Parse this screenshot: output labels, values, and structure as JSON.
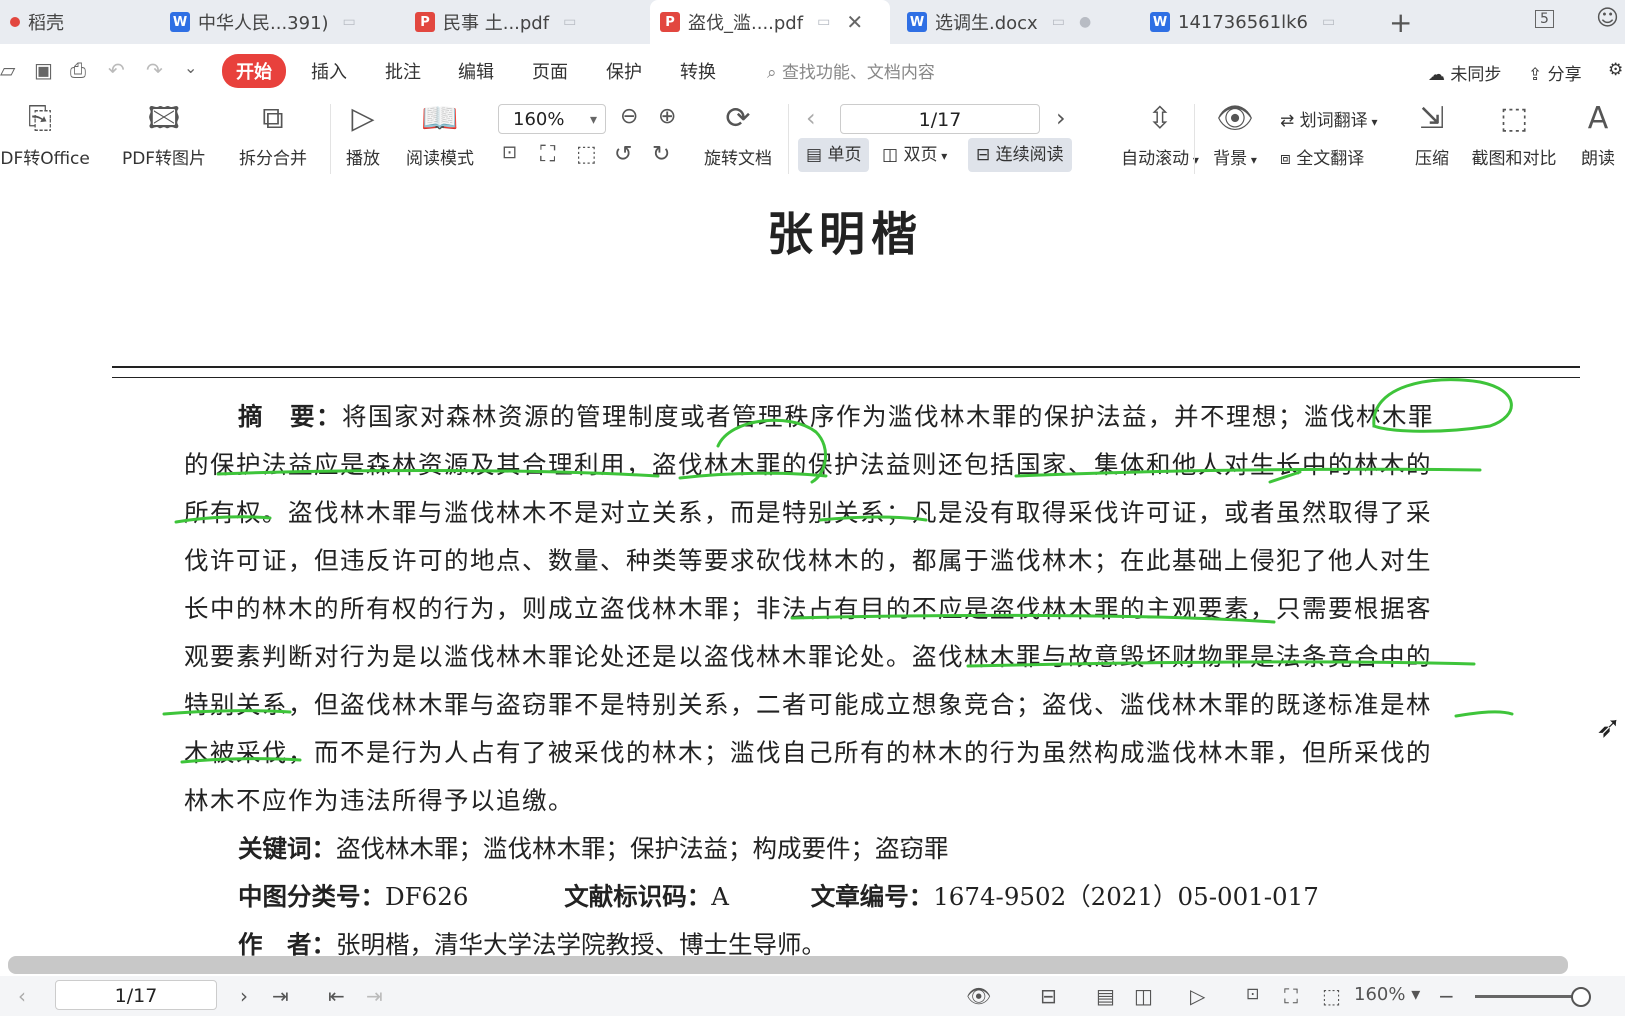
{
  "tabs": [
    {
      "label": "稻壳",
      "icon": "docer-icon"
    },
    {
      "label": "中华人民...391)",
      "icon": "word-icon"
    },
    {
      "label": "民事 土...pdf",
      "icon": "pdf-icon"
    },
    {
      "label": "盗伐_滥....pdf",
      "icon": "pdf-icon",
      "active": true
    },
    {
      "label": "选调生.docx",
      "icon": "word-icon"
    },
    {
      "label": "141736561lk6",
      "icon": "word-icon"
    }
  ],
  "tab_count_badge": "5",
  "menu": {
    "items": [
      "开始",
      "插入",
      "批注",
      "编辑",
      "页面",
      "保护",
      "转换"
    ],
    "search_placeholder": "查找功能、文档内容",
    "sync_label": "未同步",
    "share_label": "分享"
  },
  "toolbar": {
    "pdf_to_office": "PDF转Office",
    "pdf_to_image": "PDF转图片",
    "split_merge": "拆分合并",
    "play": "播放",
    "read_mode": "阅读模式",
    "zoom": "160%",
    "rotate_doc": "旋转文档",
    "page_indicator": "1/17",
    "single_page": "单页",
    "double_page": "双页",
    "continuous": "连续阅读",
    "auto_scroll": "自动滚动",
    "background": "背景",
    "word_translate": "划词翻译",
    "full_translate": "全文翻译",
    "compress": "压缩",
    "screenshot_compare": "截图和对比",
    "read_aloud": "朗读"
  },
  "document": {
    "title": "张明楷",
    "abstract_label": "摘　要：",
    "lines": [
      "将国家对森林资源的管理制度或者管理秩序作为滥伐林木罪的保护法益，并不理想；滥伐林木罪",
      "的保护法益应是森林资源及其合理利用，盗伐林木罪的保护法益则还包括国家、集体和他人对生长中的林木的",
      "所有权。盗伐林木罪与滥伐林木不是对立关系，而是特别关系；凡是没有取得采伐许可证，或者虽然取得了采",
      "伐许可证，但违反许可的地点、数量、种类等要求砍伐林木的，都属于滥伐林木；在此基础上侵犯了他人对生",
      "长中的林木的所有权的行为，则成立盗伐林木罪；非法占有目的不应是盗伐林木罪的主观要素，只需要根据客",
      "观要素判断对行为是以滥伐林木罪论处还是以盗伐林木罪论处。盗伐林木罪与故意毁坏财物罪是法条竞合中的",
      "特别关系，但盗伐林木罪与盗窃罪不是特别关系，二者可能成立想象竞合；盗伐、滥伐林木罪的既遂标准是林",
      "木被采伐，而不是行为人占有了被采伐的林木；滥伐自己所有的林木的行为虽然构成滥伐林木罪，但所采伐的",
      "林木不应作为违法所得予以追缴。"
    ],
    "keywords_label": "关键词：",
    "keywords": "盗伐林木罪；滥伐林木罪；保护法益；构成要件；盗窃罪",
    "clc_label": "中图分类号：",
    "clc": "DF626",
    "doc_code_label": "文献标识码：",
    "doc_code": "A",
    "article_no_label": "文章编号：",
    "article_no": "1674-9502（2021）05-001-017",
    "author_label": "作　者：",
    "author": "张明楷，清华大学法学院教授、博士生导师。"
  },
  "status": {
    "page": "1/17",
    "zoom": "160%"
  },
  "colors": {
    "accent_red": "#e8413c",
    "ink_green": "#3ec43a",
    "word_blue": "#2f6fe4"
  }
}
